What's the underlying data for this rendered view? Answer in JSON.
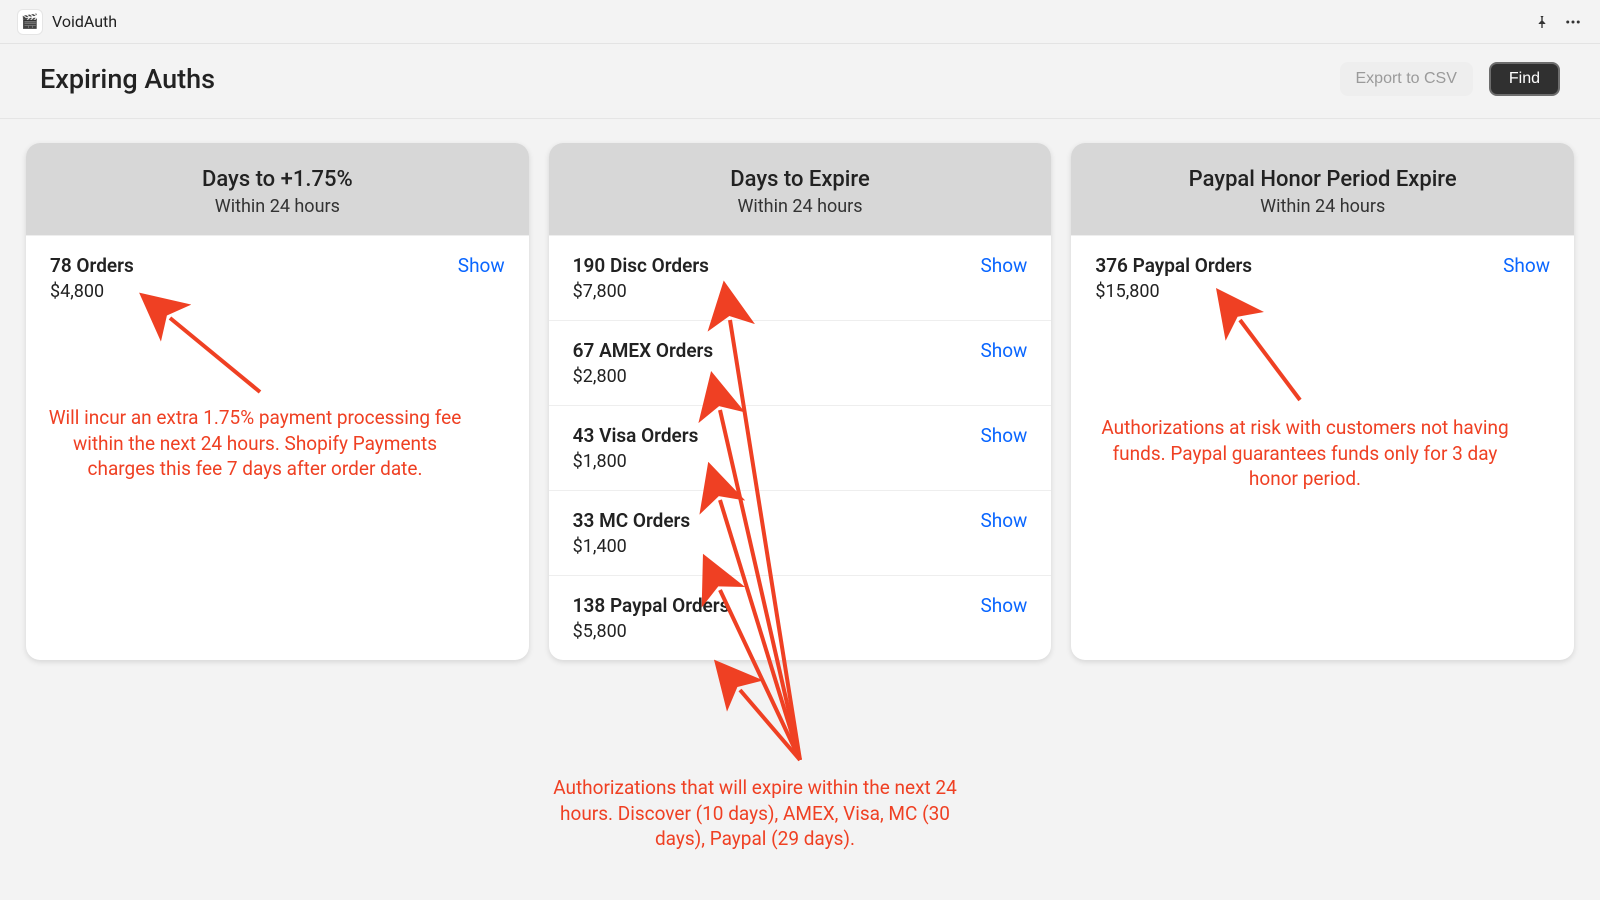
{
  "app": {
    "name": "VoidAuth"
  },
  "page": {
    "title": "Expiring Auths",
    "export_label": "Export to CSV",
    "find_label": "Find"
  },
  "annotations": {
    "fee": "Will incur an extra 1.75% payment processing fee within the next 24 hours.  Shopify Payments charges this fee 7 days after order date.",
    "expire": "Authorizations that will expire within the next 24 hours.  Discover (10 days), AMEX, Visa, MC (30 days), Paypal (29 days).",
    "paypal": "Authorizations at risk with customers not having funds.  Paypal guarantees funds only for 3 day honor period."
  },
  "show_label": "Show",
  "cards": [
    {
      "title": "Days to +1.75%",
      "subtitle": "Within 24 hours",
      "rows": [
        {
          "label": "78 Orders",
          "amount": "$4,800"
        }
      ]
    },
    {
      "title": "Days to Expire",
      "subtitle": "Within 24 hours",
      "rows": [
        {
          "label": "190 Disc Orders",
          "amount": "$7,800"
        },
        {
          "label": "67 AMEX Orders",
          "amount": "$2,800"
        },
        {
          "label": "43 Visa Orders",
          "amount": "$1,800"
        },
        {
          "label": "33 MC Orders",
          "amount": "$1,400"
        },
        {
          "label": "138 Paypal Orders",
          "amount": "$5,800"
        }
      ]
    },
    {
      "title": "Paypal Honor Period Expire",
      "subtitle": "Within 24 hours",
      "rows": [
        {
          "label": "376 Paypal Orders",
          "amount": "$15,800"
        }
      ]
    }
  ]
}
